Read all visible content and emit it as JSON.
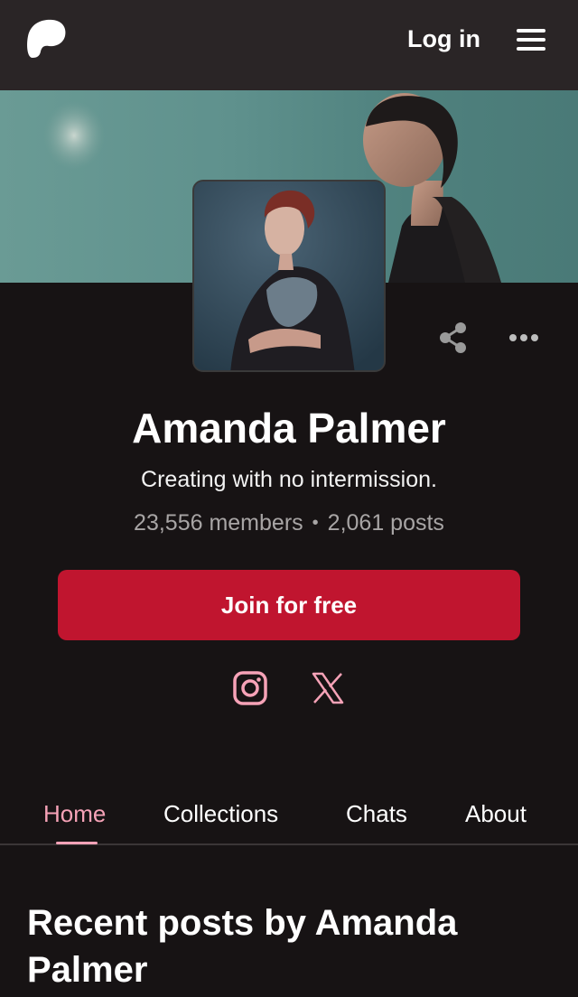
{
  "nav": {
    "login_label": "Log in",
    "logo_icon": "patreon-logo-icon",
    "menu_icon": "hamburger-menu-icon"
  },
  "profile": {
    "name": "Amanda Palmer",
    "tagline": "Creating with no intermission.",
    "members": "23,556 members",
    "separator": "•",
    "posts": "2,061 posts",
    "join_label": "Join for free"
  },
  "actions": {
    "share_icon": "share-icon",
    "more_icon": "more-options-icon"
  },
  "social": [
    {
      "icon": "instagram-icon"
    },
    {
      "icon": "x-twitter-icon"
    }
  ],
  "tabs": [
    {
      "label": "Home",
      "active": true
    },
    {
      "label": "Collections",
      "active": false
    },
    {
      "label": "Chats",
      "active": false
    },
    {
      "label": "About",
      "active": false
    }
  ],
  "feed": {
    "heading": "Recent posts by Amanda Palmer"
  },
  "colors": {
    "accent": "#c0152f",
    "active_tab": "#f6a2b7",
    "background": "#171314",
    "topbar": "#2a2526"
  }
}
